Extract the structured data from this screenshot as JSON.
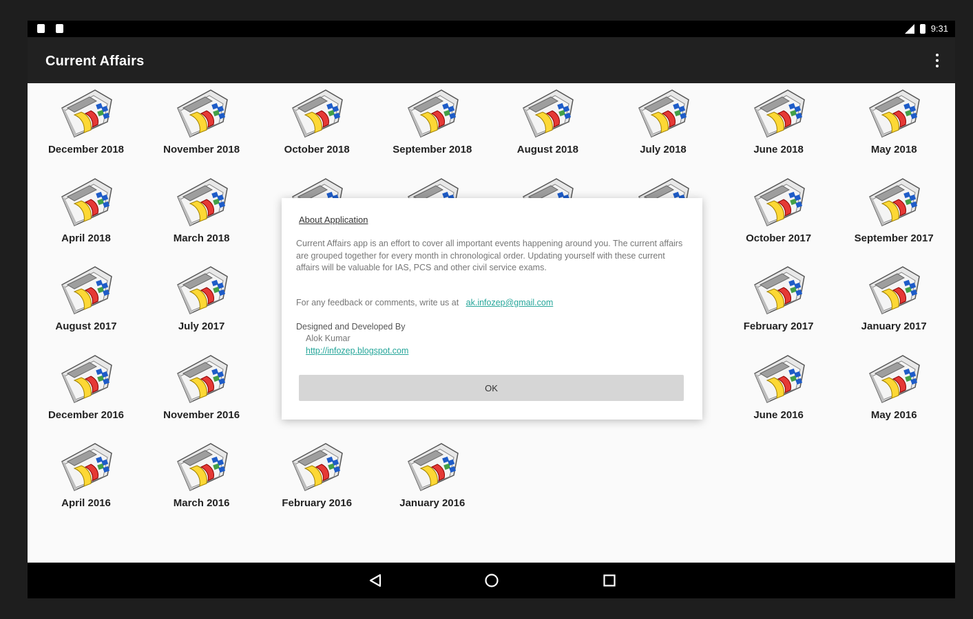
{
  "status_bar": {
    "time": "9:31"
  },
  "app_bar": {
    "title": "Current Affairs",
    "overflow_icon": "more-vert-icon"
  },
  "months": [
    {
      "label": "December 2018"
    },
    {
      "label": "November 2018"
    },
    {
      "label": "October 2018"
    },
    {
      "label": "September 2018"
    },
    {
      "label": "August 2018"
    },
    {
      "label": "July 2018"
    },
    {
      "label": "June 2018"
    },
    {
      "label": "May 2018"
    },
    {
      "label": "April 2018"
    },
    {
      "label": "March 2018"
    },
    {
      "label": ""
    },
    {
      "label": ""
    },
    {
      "label": ""
    },
    {
      "label": ""
    },
    {
      "label": "October 2017"
    },
    {
      "label": "September 2017"
    },
    {
      "label": "August 2017"
    },
    {
      "label": "July 2017"
    },
    {
      "label": ""
    },
    {
      "label": ""
    },
    {
      "label": ""
    },
    {
      "label": ""
    },
    {
      "label": "February 2017"
    },
    {
      "label": "January 2017"
    },
    {
      "label": "December 2016"
    },
    {
      "label": "November 2016"
    },
    {
      "label": ""
    },
    {
      "label": ""
    },
    {
      "label": ""
    },
    {
      "label": ""
    },
    {
      "label": "June 2016"
    },
    {
      "label": "May 2016"
    },
    {
      "label": "April 2016"
    },
    {
      "label": "March 2016"
    },
    {
      "label": "February 2016"
    },
    {
      "label": "January 2016"
    }
  ],
  "dialog": {
    "title": "About Application",
    "description": "Current Affairs app is an effort to cover all important events happening around you. The current affairs are grouped together for every month in chronological order. Updating yourself with these current affairs will be valuable for IAS, PCS and other civil service exams.",
    "feedback_prefix": "For any feedback or comments, write us at",
    "email": "ak.infozep@gmail.com",
    "developed_by": "Designed and Developed By",
    "author": "Alok Kumar",
    "website": "http://infozep.blogspot.com",
    "ok_label": "OK"
  },
  "nav_bar": {
    "back_icon": "back-icon",
    "home_icon": "home-icon",
    "recents_icon": "recents-icon"
  },
  "colors": {
    "app_bar": "#212121",
    "content_bg": "#fafafa",
    "link": "#26a69a",
    "ok_button": "#d6d6d6"
  }
}
